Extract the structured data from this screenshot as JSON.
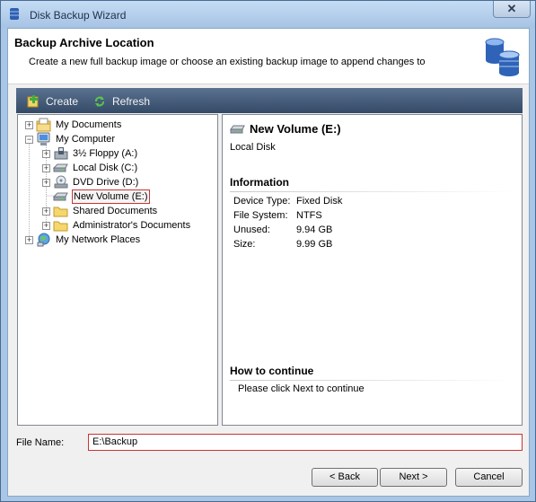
{
  "window": {
    "title": "Disk Backup Wizard",
    "close_glyph": "✕"
  },
  "header": {
    "title": "Backup Archive Location",
    "subtitle": "Create a new full backup image or choose an existing backup image to append changes to",
    "icon": "database-icon"
  },
  "toolbar": {
    "create_label": "Create",
    "refresh_label": "Refresh"
  },
  "tree": {
    "items": [
      {
        "label": "My Documents",
        "icon": "documents-folder-icon",
        "expander": "+"
      },
      {
        "label": "My Computer",
        "icon": "computer-icon",
        "expander": "−"
      },
      {
        "label": "3½ Floppy (A:)",
        "icon": "floppy-drive-icon",
        "expander": "+"
      },
      {
        "label": "Local Disk (C:)",
        "icon": "hard-disk-icon",
        "expander": "+"
      },
      {
        "label": "DVD Drive (D:)",
        "icon": "dvd-drive-icon",
        "expander": "+"
      },
      {
        "label": "New Volume (E:)",
        "icon": "hard-disk-icon",
        "expander": "",
        "selected": true
      },
      {
        "label": "Shared Documents",
        "icon": "folder-icon",
        "expander": "+"
      },
      {
        "label": "Administrator's Documents",
        "icon": "folder-icon",
        "expander": "+"
      },
      {
        "label": "My Network Places",
        "icon": "network-icon",
        "expander": "+"
      }
    ]
  },
  "detail": {
    "title": "New Volume (E:)",
    "type": "Local Disk",
    "info_heading": "Information",
    "info": [
      {
        "key": "Device Type:",
        "value": "Fixed Disk"
      },
      {
        "key": "File System:",
        "value": "NTFS"
      },
      {
        "key": "Unused:",
        "value": "9.94 GB"
      },
      {
        "key": "Size:",
        "value": "9.99 GB"
      }
    ],
    "continue_heading": "How to continue",
    "continue_text": "Please click Next to continue"
  },
  "file": {
    "label": "File Name:",
    "value": "E:\\Backup"
  },
  "buttons": {
    "back": "< Back",
    "next": "Next >",
    "cancel": "Cancel"
  },
  "colors": {
    "selection_border": "#cc3333",
    "toolbar_bg": "#3f5675",
    "window_frame": "#a9c6e6"
  }
}
